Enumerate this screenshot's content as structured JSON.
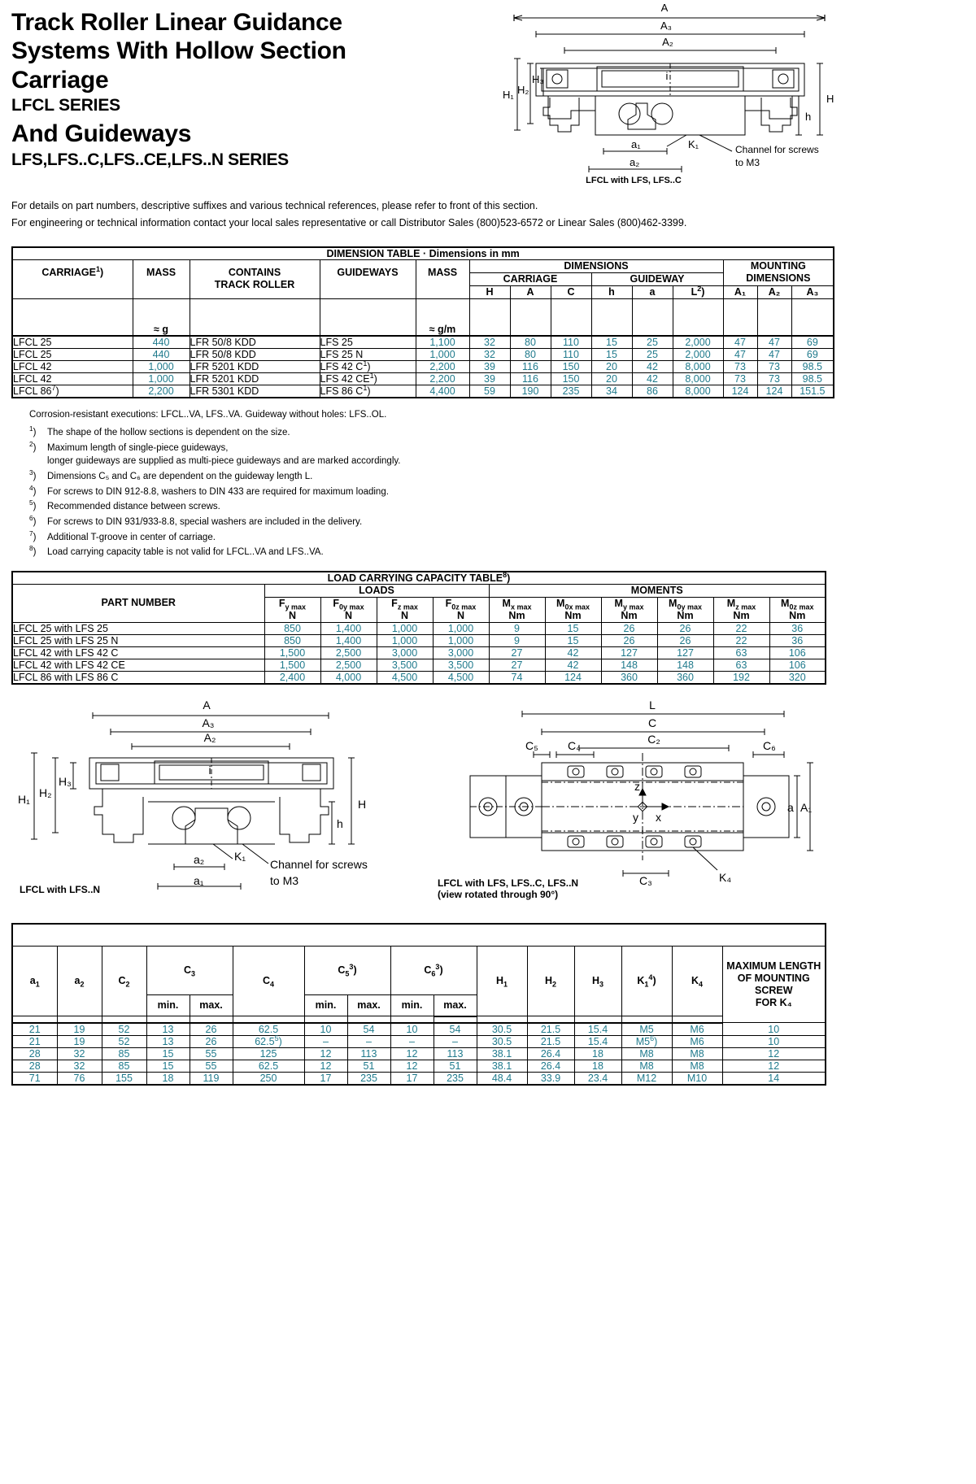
{
  "header": {
    "title_line1": "Track Roller Linear Guidance",
    "title_line2": "Systems With Hollow Section",
    "title_line3": "Carriage",
    "subtitle1": "LFCL SERIES",
    "title_line4": "And Guideways",
    "subtitle2": "LFS,LFS..C,LFS..CE,LFS..N SERIES",
    "figure_caption": "LFCL with LFS, LFS..C",
    "intro_line1": "For details on part numbers, descriptive suffixes and various technical references, please refer to front of this section.",
    "intro_line2": "For engineering or technical information contact your local sales representative or call Distributor Sales (800)523-6572 or Linear Sales (800)462-3399."
  },
  "figure_top": {
    "labels": [
      "A",
      "A₃",
      "A₂",
      "H₁",
      "H₂",
      "H₃",
      "H",
      "h",
      "i",
      "K₁",
      "a₁",
      "a₂"
    ],
    "annotation_line1": "Channel for screws",
    "annotation_line2": "to M3"
  },
  "dimension_table": {
    "title": "DIMENSION TABLE · Dimensions in mm",
    "group_headers": {
      "carriage": "CARRIAGE",
      "carriage_note": "1",
      "mass1": "MASS",
      "contains_track_roller_l1": "CONTAINS",
      "contains_track_roller_l2": "TRACK ROLLER",
      "guideways": "GUIDEWAYS",
      "mass2": "MASS",
      "dimensions": "DIMENSIONS",
      "dim_carriage": "CARRIAGE",
      "dim_guideway": "GUIDEWAY",
      "mounting_l1": "MOUNTING",
      "mounting_l2": "DIMENSIONS"
    },
    "col_labels": {
      "H": "H",
      "A": "A",
      "C": "C",
      "h": "h",
      "a": "a",
      "L": "L",
      "L_note": "2",
      "A1": "A₁",
      "A2": "A₂",
      "A3": "A₃"
    },
    "units": {
      "mass1": "≈ g",
      "mass2": "≈ g/m"
    },
    "rows": [
      {
        "carriage": "LFCL 25",
        "carriage_sup": "",
        "mass": "440",
        "track_roller": "LFR 50/8  KDD",
        "guideway": "LFS 25",
        "guideway_sup": "",
        "mass_gm": "1,100",
        "H": "32",
        "A": "80",
        "C": "110",
        "h": "15",
        "a": "25",
        "L": "2,000",
        "A1": "47",
        "A2": "47",
        "A3": "69"
      },
      {
        "carriage": "LFCL 25",
        "carriage_sup": "",
        "mass": "440",
        "track_roller": "LFR 50/8  KDD",
        "guideway": "LFS 25 N",
        "guideway_sup": "",
        "mass_gm": "1,000",
        "H": "32",
        "A": "80",
        "C": "110",
        "h": "15",
        "a": "25",
        "L": "2,000",
        "A1": "47",
        "A2": "47",
        "A3": "69"
      },
      {
        "carriage": "LFCL 42",
        "carriage_sup": "",
        "mass": "1,000",
        "track_roller": "LFR 5201  KDD",
        "guideway": "LFS 42 C",
        "guideway_sup": "1",
        "mass_gm": "2,200",
        "H": "39",
        "A": "116",
        "C": "150",
        "h": "20",
        "a": "42",
        "L": "8,000",
        "A1": "73",
        "A2": "73",
        "A3": "98.5"
      },
      {
        "carriage": "LFCL 42",
        "carriage_sup": "",
        "mass": "1,000",
        "track_roller": "LFR 5201  KDD",
        "guideway": "LFS 42 CE",
        "guideway_sup": "1",
        "mass_gm": "2,200",
        "H": "39",
        "A": "116",
        "C": "150",
        "h": "20",
        "a": "42",
        "L": "8,000",
        "A1": "73",
        "A2": "73",
        "A3": "98.5"
      },
      {
        "carriage": "LFCL 86",
        "carriage_sup": "7",
        "mass": "2,200",
        "track_roller": "LFR 5301  KDD",
        "guideway": "LFS 86 C",
        "guideway_sup": "1",
        "mass_gm": "4,400",
        "H": "59",
        "A": "190",
        "C": "235",
        "h": "34",
        "a": "86",
        "L": "8,000",
        "A1": "124",
        "A2": "124",
        "A3": "151.5"
      }
    ]
  },
  "footnotes": {
    "lead": "Corrosion-resistant executions: LFCL..VA, LFS..VA. Guideway without holes: LFS..OL.",
    "items": [
      {
        "mark": "1",
        "text": "The shape of the hollow sections is dependent on the size."
      },
      {
        "mark": "2",
        "text": "Maximum length of single-piece guideways,",
        "text2": "longer guideways are supplied as multi-piece guideways and are marked accordingly."
      },
      {
        "mark": "3",
        "text": "Dimensions C₅ and C₆ are dependent on the guideway length L."
      },
      {
        "mark": "4",
        "text": "For screws to DIN 912-8.8, washers to DIN 433 are required for maximum loading."
      },
      {
        "mark": "5",
        "text": "Recommended distance between screws."
      },
      {
        "mark": "6",
        "text": "For screws to DIN 931/933-8.8, special washers are included in the delivery."
      },
      {
        "mark": "7",
        "text": "Additional T-groove in center of carriage."
      },
      {
        "mark": "8",
        "text": "Load carrying capacity table is not valid for LFCL..VA and LFS..VA."
      }
    ]
  },
  "load_table": {
    "title": "LOAD CARRYING CAPACITY TABLE",
    "title_note": "8",
    "part_number": "PART NUMBER",
    "loads": "LOADS",
    "moments": "MOMENTS",
    "columns": [
      {
        "sym": "F",
        "sub": "y max",
        "unit": "N"
      },
      {
        "sym": "F",
        "sub": "0y max",
        "unit": "N"
      },
      {
        "sym": "F",
        "sub": "z max",
        "unit": "N"
      },
      {
        "sym": "F",
        "sub": "0z max",
        "unit": "N"
      },
      {
        "sym": "M",
        "sub": "x max",
        "unit": "Nm"
      },
      {
        "sym": "M",
        "sub": "0x max",
        "unit": "Nm"
      },
      {
        "sym": "M",
        "sub": "y max",
        "unit": "Nm"
      },
      {
        "sym": "M",
        "sub": "0y max",
        "unit": "Nm"
      },
      {
        "sym": "M",
        "sub": "z max",
        "unit": "Nm"
      },
      {
        "sym": "M",
        "sub": "0z max",
        "unit": "Nm"
      }
    ],
    "rows": [
      {
        "part": "LFCL 25 with LFS 25",
        "v": [
          "850",
          "1,400",
          "1,000",
          "1,000",
          "9",
          "15",
          "26",
          "26",
          "22",
          "36"
        ]
      },
      {
        "part": "LFCL 25 with LFS 25 N",
        "v": [
          "850",
          "1,400",
          "1,000",
          "1,000",
          "9",
          "15",
          "26",
          "26",
          "22",
          "36"
        ]
      },
      {
        "part": "LFCL 42 with LFS 42 C",
        "v": [
          "1,500",
          "2,500",
          "3,000",
          "3,000",
          "27",
          "42",
          "127",
          "127",
          "63",
          "106"
        ]
      },
      {
        "part": "LFCL 42 with LFS 42 CE",
        "v": [
          "1,500",
          "2,500",
          "3,500",
          "3,500",
          "27",
          "42",
          "148",
          "148",
          "63",
          "106"
        ]
      },
      {
        "part": "LFCL 86 with LFS 86 C",
        "v": [
          "2,400",
          "4,000",
          "4,500",
          "4,500",
          "74",
          "124",
          "360",
          "360",
          "192",
          "320"
        ]
      }
    ]
  },
  "figure_left": {
    "caption": "LFCL with LFS..N",
    "labels": [
      "A",
      "A₃",
      "A₂",
      "H₁",
      "H₂",
      "H₃",
      "H",
      "h",
      "i",
      "K₁",
      "a₁",
      "a₂"
    ],
    "annotation_line1": "Channel for screws",
    "annotation_line2": "to M3"
  },
  "figure_right": {
    "caption_line1": "LFCL with LFS, LFS..C, LFS..N",
    "caption_line2": "(view rotated through 90°)",
    "labels": [
      "L",
      "C",
      "C₂",
      "C₃",
      "C₄",
      "C₅",
      "C₆",
      "a",
      "A₁",
      "K₄",
      "x",
      "y",
      "z"
    ]
  },
  "bottom_table": {
    "headers": [
      {
        "sym": "a",
        "sub": "1",
        "sup": ""
      },
      {
        "sym": "a",
        "sub": "2",
        "sup": ""
      },
      {
        "sym": "C",
        "sub": "2",
        "sup": ""
      },
      {
        "sym": "C",
        "sub": "3",
        "sup": ""
      },
      {
        "sym": "C",
        "sub": "4",
        "sup": ""
      },
      {
        "sym": "C",
        "sub": "5",
        "sup": "3"
      },
      {
        "sym": "C",
        "sub": "6",
        "sup": "3"
      },
      {
        "sym": "H",
        "sub": "1",
        "sup": ""
      },
      {
        "sym": "H",
        "sub": "2",
        "sup": ""
      },
      {
        "sym": "H",
        "sub": "3",
        "sup": ""
      },
      {
        "sym": "K",
        "sub": "1",
        "sup": "4"
      },
      {
        "sym": "K",
        "sub": "4",
        "sup": ""
      }
    ],
    "minmax": {
      "min": "min.",
      "max": "max."
    },
    "max_len_l1": "MAXIMUM LENGTH",
    "max_len_l2": "OF MOUNTING SCREW",
    "max_len_l3": "FOR K₄",
    "rows": [
      {
        "a1": "21",
        "a2": "19",
        "C2": "52",
        "C3min": "13",
        "C3max": "26",
        "C4": "62.5",
        "C4sup": "",
        "C5min": "10",
        "C5max": "54",
        "C6min": "10",
        "C6max": "54",
        "H1": "30.5",
        "H2": "21.5",
        "H3": "15.4",
        "K1": "M5",
        "K1sup": "",
        "K4": "M6",
        "maxlen": "10"
      },
      {
        "a1": "21",
        "a2": "19",
        "C2": "52",
        "C3min": "13",
        "C3max": "26",
        "C4": "62.5",
        "C4sup": "5",
        "C5min": "–",
        "C5max": "–",
        "C6min": "–",
        "C6max": "–",
        "H1": "30.5",
        "H2": "21.5",
        "H3": "15.4",
        "K1": "M5",
        "K1sup": "6",
        "K4": "M6",
        "maxlen": "10"
      },
      {
        "a1": "28",
        "a2": "32",
        "C2": "85",
        "C3min": "15",
        "C3max": "55",
        "C4": "125",
        "C4sup": "",
        "C5min": "12",
        "C5max": "113",
        "C6min": "12",
        "C6max": "113",
        "H1": "38.1",
        "H2": "26.4",
        "H3": "18",
        "K1": "M8",
        "K1sup": "",
        "K4": "M8",
        "maxlen": "12"
      },
      {
        "a1": "28",
        "a2": "32",
        "C2": "85",
        "C3min": "15",
        "C3max": "55",
        "C4": "62.5",
        "C4sup": "",
        "C5min": "12",
        "C5max": "51",
        "C6min": "12",
        "C6max": "51",
        "H1": "38.1",
        "H2": "26.4",
        "H3": "18",
        "K1": "M8",
        "K1sup": "",
        "K4": "M8",
        "maxlen": "12"
      },
      {
        "a1": "71",
        "a2": "76",
        "C2": "155",
        "C3min": "18",
        "C3max": "119",
        "C4": "250",
        "C4sup": "",
        "C5min": "17",
        "C5max": "235",
        "C6min": "17",
        "C6max": "235",
        "H1": "48.4",
        "H2": "33.9",
        "H3": "23.4",
        "K1": "M12",
        "K1sup": "",
        "K4": "M10",
        "maxlen": "14"
      }
    ]
  }
}
